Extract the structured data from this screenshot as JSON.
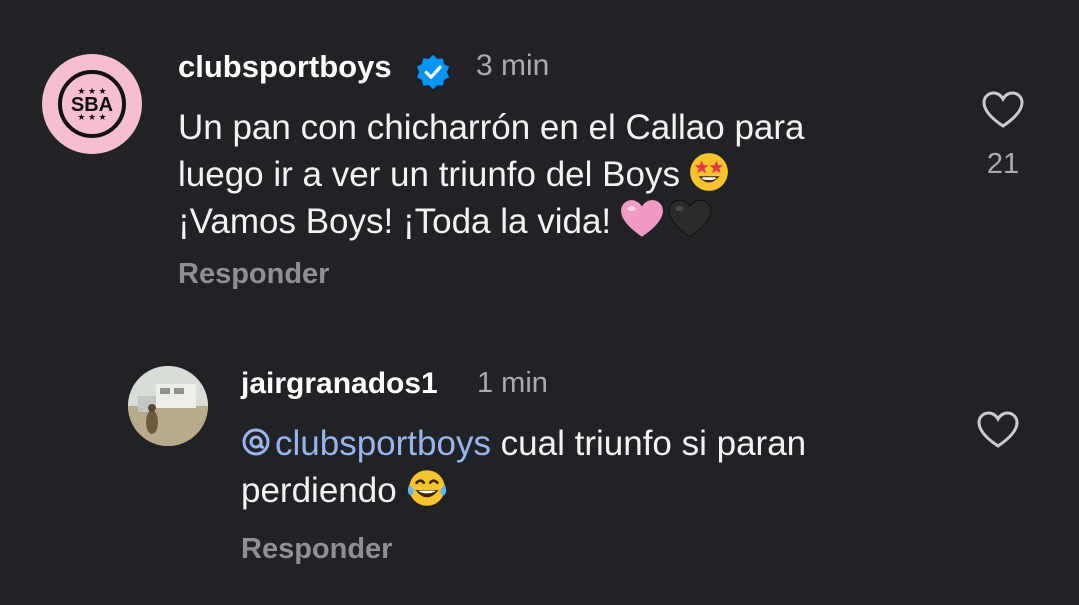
{
  "comments": [
    {
      "username": "clubsportboys",
      "avatar_text": "SBA",
      "verified": true,
      "time": "3 min",
      "lines": [
        "Un pan con chicharrón en el Callao para",
        "luego ir a ver un triunfo del Boys",
        "¡Vamos Boys! ¡Toda la vida!"
      ],
      "reply_label": "Responder",
      "like_count": "21"
    },
    {
      "username": "jairgranados1",
      "time": "1 min",
      "mention": "clubsportboys",
      "line1_rest": " cual triunfo si paran",
      "line2": "perdiendo",
      "reply_label": "Responder"
    }
  ],
  "colors": {
    "background": "#202226",
    "avatar_pink": "#f6bed1",
    "verified_blue": "#0095f6",
    "mention": "#9ab5ec",
    "muted": "#a9abb0"
  },
  "icons": [
    "verified-badge-icon",
    "heart-outline-icon",
    "threads-at-icon",
    "star-struck-emoji",
    "pink-heart-emoji",
    "black-heart-emoji",
    "tears-of-joy-emoji"
  ]
}
